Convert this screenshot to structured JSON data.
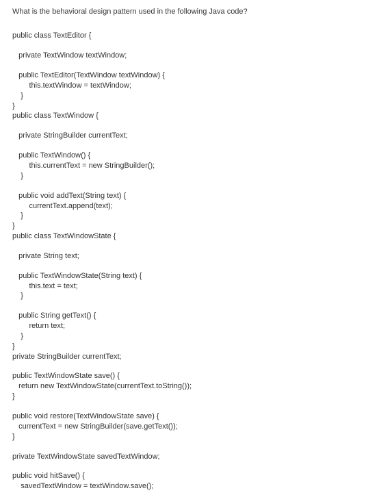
{
  "question": "What is the behavioral design pattern used in the following Java code?",
  "code_lines": [
    "public class TextEditor {",
    "",
    "   private TextWindow textWindow;",
    "",
    "   public TextEditor(TextWindow textWindow) {",
    "        this.textWindow = textWindow;",
    "    }",
    "}",
    "public class TextWindow {",
    "",
    "   private StringBuilder currentText;",
    "",
    "   public TextWindow() {",
    "        this.currentText = new StringBuilder();",
    "    }",
    "",
    "   public void addText(String text) {",
    "        currentText.append(text);",
    "    }",
    "}",
    "public class TextWindowState {",
    "",
    "   private String text;",
    "",
    "   public TextWindowState(String text) {",
    "        this.text = text;",
    "    }",
    "",
    "   public String getText() {",
    "        return text;",
    "    }",
    "}",
    "private StringBuilder currentText;",
    "",
    "public TextWindowState save() {",
    "   return new TextWindowState(currentText.toString());",
    "}",
    "",
    "public void restore(TextWindowState save) {",
    "   currentText = new StringBuilder(save.getText());",
    "}",
    "",
    "private TextWindowState savedTextWindow;",
    "",
    "public void hitSave() {",
    "    savedTextWindow = textWindow.save();"
  ]
}
